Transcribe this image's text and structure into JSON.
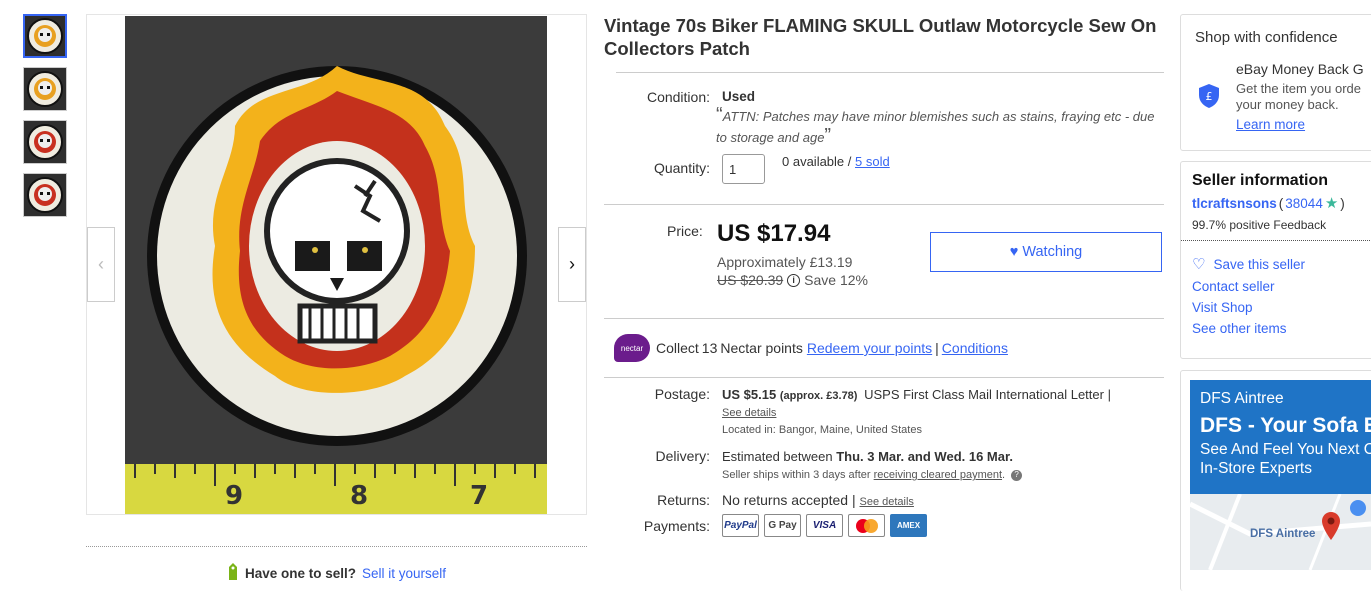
{
  "thumbnails": [
    {
      "label": "thumbnail-1",
      "active": true
    },
    {
      "label": "thumbnail-2",
      "active": false
    },
    {
      "label": "thumbnail-3",
      "active": false
    },
    {
      "label": "thumbnail-4",
      "active": false
    }
  ],
  "listing": {
    "title": "Vintage 70s Biker FLAMING SKULL Outlaw Motorcycle Sew On Collectors Patch",
    "condition_label": "Condition:",
    "condition_value": "Used",
    "condition_note": "ATTN: Patches may have minor blemishes such as stains, fraying etc - due to storage and age",
    "quantity_label": "Quantity:",
    "quantity_value": "1",
    "available_text": "0 available /",
    "sold_link": "5 sold",
    "price_label": "Price:",
    "price": "US $17.94",
    "approx": "Approximately £13.19",
    "was_price": "US $20.39",
    "save_text": "Save 12%",
    "watch_label": "Watching",
    "nectar_logo": "nectar",
    "nectar_text_pre": "Collect ",
    "nectar_points": "13",
    "nectar_text_post": " Nectar points",
    "redeem_link": "Redeem your points",
    "pipe": "|",
    "conditions_link": "Conditions",
    "postage_label": "Postage:",
    "postage_value": "US $5.15",
    "postage_approx": "(approx. £3.78)",
    "postage_service": "USPS First Class Mail International Letter |",
    "see_details": "See details",
    "located_in": "Located in:  Bangor, Maine, United States",
    "delivery_label": "Delivery:",
    "delivery_pre": "Estimated between ",
    "delivery_dates": "Thu. 3 Mar. and Wed. 16 Mar.",
    "ships_pre": "Seller ships within 3 days after ",
    "ships_link": "receiving cleared payment",
    "ships_post": ".",
    "returns_label": "Returns:",
    "returns_value": "No returns accepted |",
    "returns_see_details": "See details",
    "payments_label": "Payments:",
    "payments": [
      "PayPal",
      "G Pay",
      "VISA",
      "",
      "AMEX"
    ]
  },
  "sell": {
    "have_one": "Have one to sell?",
    "sell_link": "Sell it yourself"
  },
  "confidence": {
    "heading": "Shop with confidence",
    "mbg_title": "eBay Money Back G",
    "mbg_desc": "Get the item you orde your money back.",
    "learn_more": "Learn more"
  },
  "seller": {
    "heading": "Seller information",
    "name": "tlcraftsnsons",
    "score_open": "(",
    "score": "38044",
    "score_close": ")",
    "feedback": "99.7% positive Feedback",
    "save_seller": "Save this seller",
    "contact": "Contact seller",
    "visit_shop": "Visit Shop",
    "other_items": "See other items"
  },
  "ad": {
    "brand": "DFS Aintree",
    "headline": "DFS - Your Sofa E",
    "sub": "See And Feel You Next Our In-Store Experts",
    "map_label": "DFS Aintree",
    "colors": {
      "bg": "#1f74c6",
      "map": "#e8ecef"
    }
  },
  "colors": {
    "link": "#3665f3",
    "text": "#333333",
    "price": "#111111"
  }
}
